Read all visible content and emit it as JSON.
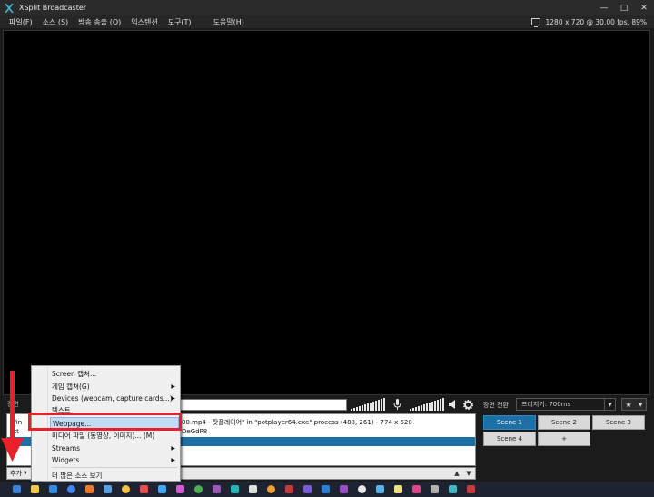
{
  "window": {
    "title": "XSplit Broadcaster",
    "controls": {
      "minimize": "—",
      "maximize": "□",
      "close": "✕"
    }
  },
  "menu": [
    {
      "label": "파일(F)"
    },
    {
      "label": "소스 (S)"
    },
    {
      "label": "방송 송출 (O)"
    },
    {
      "label": "익스텐션"
    },
    {
      "label": "도구(T)"
    },
    {
      "label": "도움말(H)"
    }
  ],
  "stats": "1280 x 720 @ 30.00 fps, 89%",
  "under_preview": {
    "label": "장면"
  },
  "scene_transition": {
    "label": "장면 전환",
    "selected": "프리지기: 700ms"
  },
  "sources": {
    "rows": [
      {
        "prefix": "Win",
        "text": "00.mp4 - 팟플레이어\" in \"potplayer64.exe\" process (488, 261) - 774 x 520"
      },
      {
        "prefix": "htt",
        "text": "DeGdP8"
      },
      {
        "prefix": "",
        "text": ""
      }
    ]
  },
  "bottom_bar": {
    "add_label": "추가"
  },
  "scenes": [
    {
      "label": "Scene 1",
      "active": true
    },
    {
      "label": "Scene 2",
      "active": false
    },
    {
      "label": "Scene 3",
      "active": false
    },
    {
      "label": "Scene 4",
      "active": false
    },
    {
      "label": "+",
      "active": false
    }
  ],
  "context_menu": {
    "items": [
      {
        "label": "Screen 캡쳐..."
      },
      {
        "label": "게임 캡쳐(G)",
        "submenu": true
      },
      {
        "label": "Devices (webcam, capture cards...)",
        "submenu": true
      },
      {
        "label": "텍스트"
      },
      {
        "label": "Webpage...",
        "highlighted": true
      },
      {
        "label": "미디어 파일 (동영상, 이미지)... (M)"
      },
      {
        "label": "Streams",
        "submenu": true
      },
      {
        "label": "Widgets",
        "submenu": true
      },
      {
        "label": "더 많은 소스 보기"
      }
    ]
  },
  "colors": {
    "accent": "#1d6fa5",
    "annotation_red": "#e8202a",
    "menu_highlight": "#c2ddf3"
  }
}
